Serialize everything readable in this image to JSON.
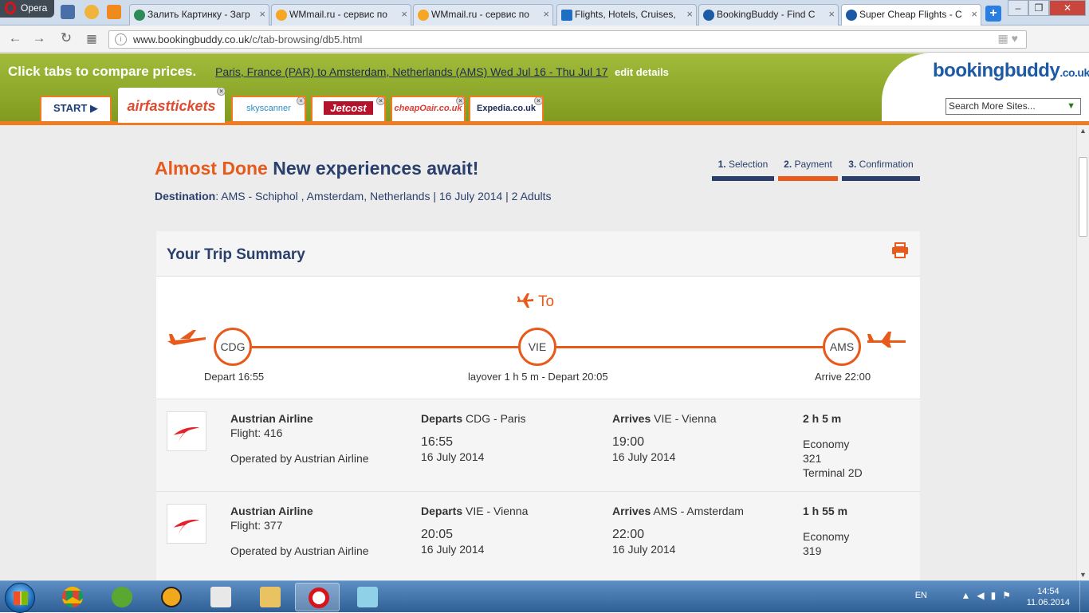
{
  "browser": {
    "menu_label": "Opera",
    "tabs": [
      {
        "label": "Залить Картинку - Загр",
        "color": "#2e8b57"
      },
      {
        "label": "WMmail.ru - сервис по",
        "color": "#f5a623"
      },
      {
        "label": "WMmail.ru - сервис по",
        "color": "#f5a623"
      },
      {
        "label": "Flights, Hotels, Cruises,",
        "color": "#1e6fc4"
      },
      {
        "label": "BookingBuddy - Find C",
        "color": "#1d5aa6"
      },
      {
        "label": "Super Cheap Flights - C",
        "color": "#1d5aa6"
      }
    ],
    "new_tab": "+",
    "url_host": "www.bookingbuddy.co.uk",
    "url_path": "/c/tab-browsing/db5.html"
  },
  "bb": {
    "compare": "Click tabs to compare prices.",
    "route": "Paris, France (PAR) to Amsterdam, Netherlands (AMS) Wed Jul 16 - Thu Jul 17",
    "edit": "edit details",
    "logo_main": "bookingbuddy",
    "logo_domain": ".co.uk",
    "search_sites": "Search More Sites...",
    "provider_tabs": [
      "START ▶",
      "airfasttickets",
      "skyscanner",
      "Jetcost",
      "cheapOair.co.uk",
      "Expedia.co.uk"
    ]
  },
  "page": {
    "headline_highlight": "Almost Done",
    "headline_rest": "New experiences await!",
    "destination_label": "Destination",
    "destination_value": ": AMS - Schiphol , Amsterdam, Netherlands | 16 July 2014 | 2 Adults",
    "steps": [
      {
        "num": "1.",
        "label": "Selection"
      },
      {
        "num": "2.",
        "label": "Payment"
      },
      {
        "num": "3.",
        "label": "Confirmation"
      }
    ],
    "summary_title": "Your Trip Summary",
    "to_label": "To",
    "stops": [
      {
        "code": "CDG",
        "caption": "Depart 16:55"
      },
      {
        "code": "VIE",
        "caption": "layover 1 h 5 m - Depart 20:05"
      },
      {
        "code": "AMS",
        "caption": "Arrive 22:00"
      }
    ],
    "segments": [
      {
        "airline": "Austrian Airline",
        "flight_label": "Flight:",
        "flight": "416",
        "operated": "Operated by Austrian Airline",
        "dep_label": "Departs",
        "dep_place": "CDG - Paris",
        "dep_time": "16:55",
        "dep_date": "16 July 2014",
        "arr_label": "Arrives",
        "arr_place": "VIE - Vienna",
        "arr_time": "19:00",
        "arr_date": "16 July 2014",
        "duration": "2 h 5 m",
        "class": "Economy",
        "aircraft": "321",
        "terminal": "Terminal 2D"
      },
      {
        "airline": "Austrian Airline",
        "flight_label": "Flight:",
        "flight": "377",
        "operated": "Operated by Austrian Airline",
        "dep_label": "Departs",
        "dep_place": "VIE - Vienna",
        "dep_time": "20:05",
        "dep_date": "16 July 2014",
        "arr_label": "Arrives",
        "arr_place": "AMS - Amsterdam",
        "arr_time": "22:00",
        "arr_date": "16 July 2014",
        "duration": "1 h 55 m",
        "class": "Economy",
        "aircraft": "319",
        "terminal": ""
      }
    ]
  },
  "taskbar": {
    "lang": "EN",
    "time": "14:54",
    "date": "11.06.2014"
  },
  "colors": {
    "accent": "#e85a1b",
    "navy": "#2a3f6c",
    "green": "#8fa82a"
  }
}
